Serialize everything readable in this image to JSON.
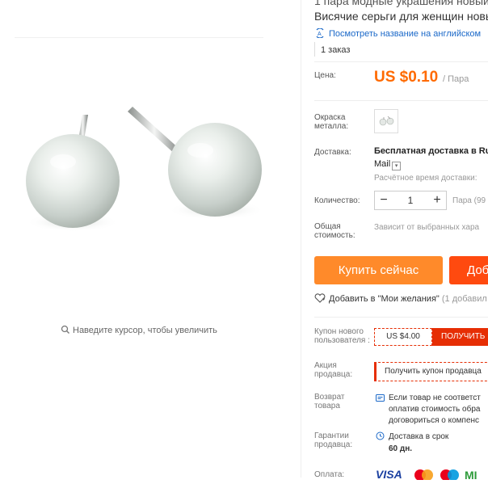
{
  "product": {
    "title_line1": "1 пара модные украшения новый",
    "title_line2": "Висячие серьги для женщин новы",
    "translate_link": "Посмотреть название на английском",
    "orders": "1 заказ",
    "zoom_hint": "Наведите курсор, чтобы увеличить"
  },
  "price": {
    "label": "Цена:",
    "value": "US $0.10",
    "unit": "/ Пара"
  },
  "color": {
    "label": "Окраска металла:"
  },
  "shipping": {
    "label": "Доставка:",
    "main": "Бесплатная доставка в Ru",
    "method": "Mail",
    "estimate": "Расчётное время доставки:"
  },
  "quantity": {
    "label": "Количество:",
    "minus": "−",
    "value": "1",
    "plus": "+",
    "unit": "Пара (99"
  },
  "total": {
    "label": "Общая стоимость:",
    "value": "Зависит от выбранных хара"
  },
  "actions": {
    "buy_now": "Купить сейчас",
    "add_to_cart": "Доб",
    "wishlist": "Добавить в \"Мои желания\"",
    "wishlist_count": "(1 добавил"
  },
  "coupons": {
    "new_user_label": "Купон нового пользователя :",
    "new_user_value": "US $4.00",
    "get_button": "ПОЛУЧИТЬ",
    "seller_label": "Акция продавца:",
    "seller_coupon": "Получить купон продавца"
  },
  "returns": {
    "label": "Возврат товара",
    "line1": "Если товар не соответст",
    "line2": "оплатив стоимость обра",
    "line3": "договориться о компенс"
  },
  "guarantee": {
    "label": "Гарантии продавца:",
    "line1": "Доставка в срок",
    "line2": "60 дн."
  },
  "payment": {
    "label": "Оплата:"
  },
  "colors": {
    "accent": "#ff6a00",
    "buy": "#ff8a2a",
    "cart": "#ff4a0f",
    "coupon": "#e62e04",
    "link": "#1a68c8"
  }
}
